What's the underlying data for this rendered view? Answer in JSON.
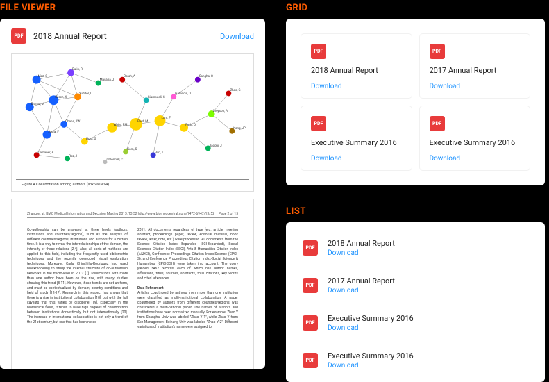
{
  "sections": {
    "file_viewer_title": "FILE VIEWER",
    "grid_title": "GRID",
    "list_title": "LIST"
  },
  "labels": {
    "download": "Download",
    "pdf_badge": "PDF"
  },
  "viewer": {
    "title": "2018 Annual Report",
    "figure_caption": "Figure 4 Collaboration among authors (link value>4).",
    "page_header_left": "Zhang et al. BMC Medical Informatics and Decision Making 2013, 13:52  http://www.biomedcentral.com/1472-6947/13/52",
    "page_header_right": "Page 2 of 15",
    "graph_labels": [
      "Nizz, S",
      "Balin, R",
      "Brams, M",
      "Riisch, K",
      "Yuddor, L",
      "Chans, JW",
      "Arora, F",
      "Castaner, A",
      "Roz, J",
      "Hora, G",
      "Masana, J",
      "White, RM",
      "Pard, M",
      "Lam, F",
      "Peds, D",
      "Giampaoli, S",
      "Garancis, D",
      "Borah, A",
      "Sangha, O",
      "Gam, S",
      "Han, T",
      "Greyson, A",
      "Jacobi, J",
      "Zhao, G",
      "Kang, JP",
      "O'Donnell, C"
    ],
    "col_left": "Co-authorship can be analysed at three levels (authors, institutions and countries/regions), such as the analysis of different countries/regions, institutions and authors for a certain time. It is a way to reveal the interrelationships of the domain, the intensity of these relations [2,4]. Also, all sorts of methods are applied to this field, including the frequently used bibliometric techniques and the recently developed visual exploration techniques. Moreover, Carla Chinchilla-Rodriguez had used blockmodeling to study the internal structure of co-authorship networks in the micro-level in 2012 [7].\n\nPublications with more than one author have been on the rise, with many studies showing this trend [8-11]. However, these trends are not uniform, and must be contextualized by domain, country conditions and field of study [12-17]. Research in this respect has shown that there is a rise in institutional collaboration [18], but with the full caveats that this varies by discipline [19]. Especially in the biomedical fields, it tends to have high degrees of collaboration between institutions domestically, but not internationally [20].\n\nThe increase in international collaboration is not only a trend of the 21st century, but one that has been noted",
    "subheading": "Data Refinement",
    "col_right_top": "2011. All documents regardless of type (e.g. article, meeting abstract, proceedings paper, review, editorial material, book review, letter, note, etc.) were processed. All documents from the Science Citation Index Expanded (SCI-Expanded), Social Sciences Citation Index (SSCI), Arts & Humanities Citation Index (A&HCI), Conference Proceedings Citation Index-Science (CPCI-S), and Conference Proceedings Citation Index-Social Science & Humanities (CPCI-SSH) were taken into account. The query yielded 3467 records, each of which has author names, affiliations, titles, sources, abstracts, total citations, key words and cited references.",
    "col_right_bottom": "Articles coauthored by authors from more than one institution were classified as multi-institutional collaboration. A paper coauthored by authors from different countries/regions was considered a multi-national paper.\n\nThe names of authors and institutions have been normalized manually. For example, Zhao Y from Shanghai Univ was labeled \"Zhao Y 1\", while Zhao Y from Sch Management Beihang Univ was labeled \"Zhao Y 2\". Different variations of institution's name were assigned to"
  },
  "grid_items": [
    {
      "title": "2018 Annual Report"
    },
    {
      "title": "2017 Annual Report"
    },
    {
      "title": "Executive Summary 2016"
    },
    {
      "title": "Executive Summary 2016"
    }
  ],
  "list_items": [
    {
      "title": "2018 Annual Report"
    },
    {
      "title": "2017 Annual Report"
    },
    {
      "title": "Executive Summary 2016"
    },
    {
      "title": "Executive Summary 2016"
    }
  ]
}
